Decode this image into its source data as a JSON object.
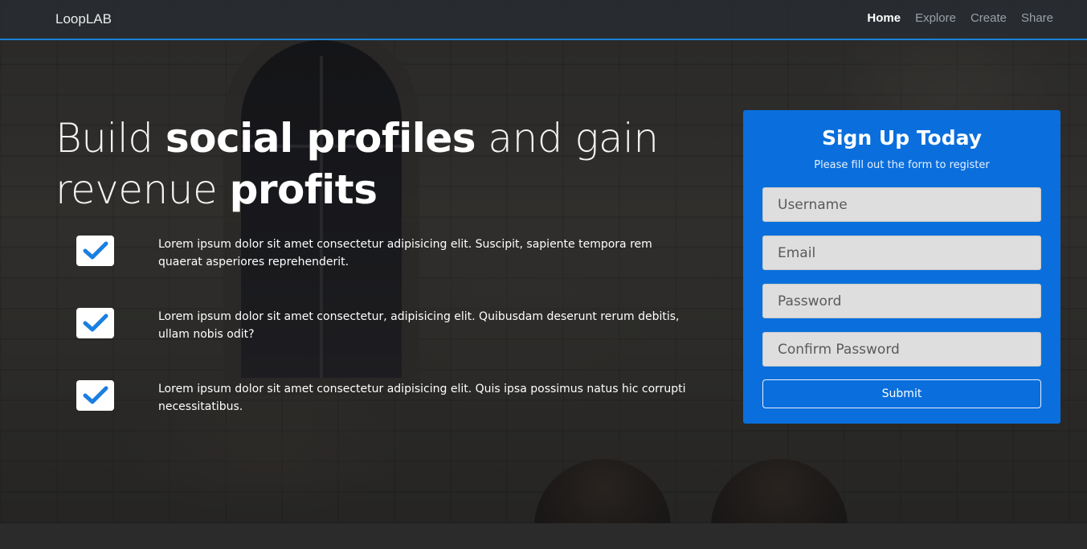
{
  "navbar": {
    "brand": "LoopLAB",
    "links": [
      {
        "label": "Home",
        "active": true
      },
      {
        "label": "Explore",
        "active": false
      },
      {
        "label": "Create",
        "active": false
      },
      {
        "label": "Share",
        "active": false
      }
    ]
  },
  "hero": {
    "headline": {
      "part1": "Build ",
      "bold1": "social profiles",
      "part2": " and gain revenue ",
      "bold2": "profits"
    },
    "features": [
      {
        "icon": "check-icon",
        "text": "Lorem ipsum dolor sit amet consectetur adipisicing elit. Suscipit, sapiente tempora rem quaerat asperiores reprehenderit."
      },
      {
        "icon": "check-icon",
        "text": "Lorem ipsum dolor sit amet consectetur, adipisicing elit. Quibusdam deserunt rerum debitis, ullam nobis odit?"
      },
      {
        "icon": "check-icon",
        "text": "Lorem ipsum dolor sit amet consectetur adipisicing elit. Quis ipsa possimus natus hic corrupti necessitatibus."
      }
    ]
  },
  "signup": {
    "title": "Sign Up Today",
    "subtitle": "Please fill out the form to register",
    "fields": {
      "username_placeholder": "Username",
      "email_placeholder": "Email",
      "password_placeholder": "Password",
      "confirm_placeholder": "Confirm Password"
    },
    "submit_label": "Submit"
  },
  "colors": {
    "accent": "#0a6fdc",
    "nav_border": "#1a82d6",
    "check": "#1a7fe0"
  }
}
